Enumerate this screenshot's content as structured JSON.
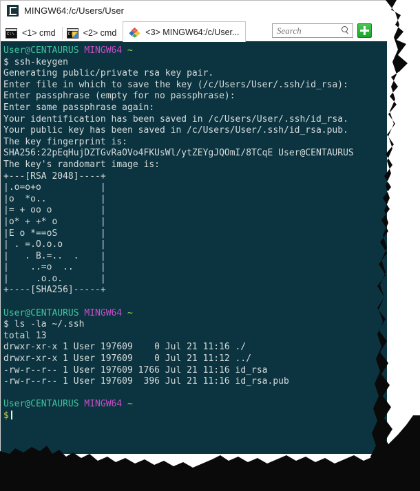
{
  "window": {
    "title": "MINGW64:/c/Users/User",
    "title_icon": "console-app-icon"
  },
  "tabs": [
    {
      "label": "<1> cmd",
      "icon": "console-icon",
      "active": false
    },
    {
      "label": "<2> cmd",
      "icon": "console-shield-icon",
      "active": false
    },
    {
      "label": "<3> MINGW64:/c/User...",
      "icon": "git-bash-icon",
      "active": true
    }
  ],
  "search": {
    "placeholder": "Search",
    "value": "",
    "icon": "search-icon",
    "new_tab_icon": "plus-icon"
  },
  "terminal": {
    "background": "#0c3440",
    "colors": {
      "user": "#3fc4a0",
      "host": "#c74ec7",
      "path": "#9fd84a",
      "prompt": "#d6d64a",
      "text": "#d6dcdc"
    },
    "prompt": {
      "user": "User@CENTAURUS",
      "host": "MINGW64",
      "path": "~",
      "symbol": "$"
    },
    "blocks": [
      {
        "command": "ssh-keygen",
        "output": [
          "Generating public/private rsa key pair.",
          "Enter file in which to save the key (/c/Users/User/.ssh/id_rsa):",
          "Enter passphrase (empty for no passphrase):",
          "Enter same passphrase again:",
          "Your identification has been saved in /c/Users/User/.ssh/id_rsa.",
          "Your public key has been saved in /c/Users/User/.ssh/id_rsa.pub.",
          "The key fingerprint is:",
          "SHA256:22pEqHujDZTGvRaOVo4FKUsWl/ytZEYgJQOmI/8TCqE User@CENTAURUS",
          "The key's randomart image is:",
          "+---[RSA 2048]----+",
          "|.o=o+o           |",
          "|o  *o..          |",
          "|= + oo o         |",
          "|o* + +* o        |",
          "|E o *==oS        |",
          "| . =.O.o.o       |",
          "|   . B.=..  .    |",
          "|    ..=o  ..     |",
          "|     .o.o.       |",
          "+----[SHA256]-----+"
        ]
      },
      {
        "command": "ls -la ~/.ssh",
        "output": [
          "total 13",
          "drwxr-xr-x 1 User 197609    0 Jul 21 11:16 ./",
          "drwxr-xr-x 1 User 197609    0 Jul 21 11:12 ../",
          "-rw-r--r-- 1 User 197609 1766 Jul 21 11:16 id_rsa",
          "-rw-r--r-- 1 User 197609  396 Jul 21 11:16 id_rsa.pub"
        ]
      }
    ]
  }
}
